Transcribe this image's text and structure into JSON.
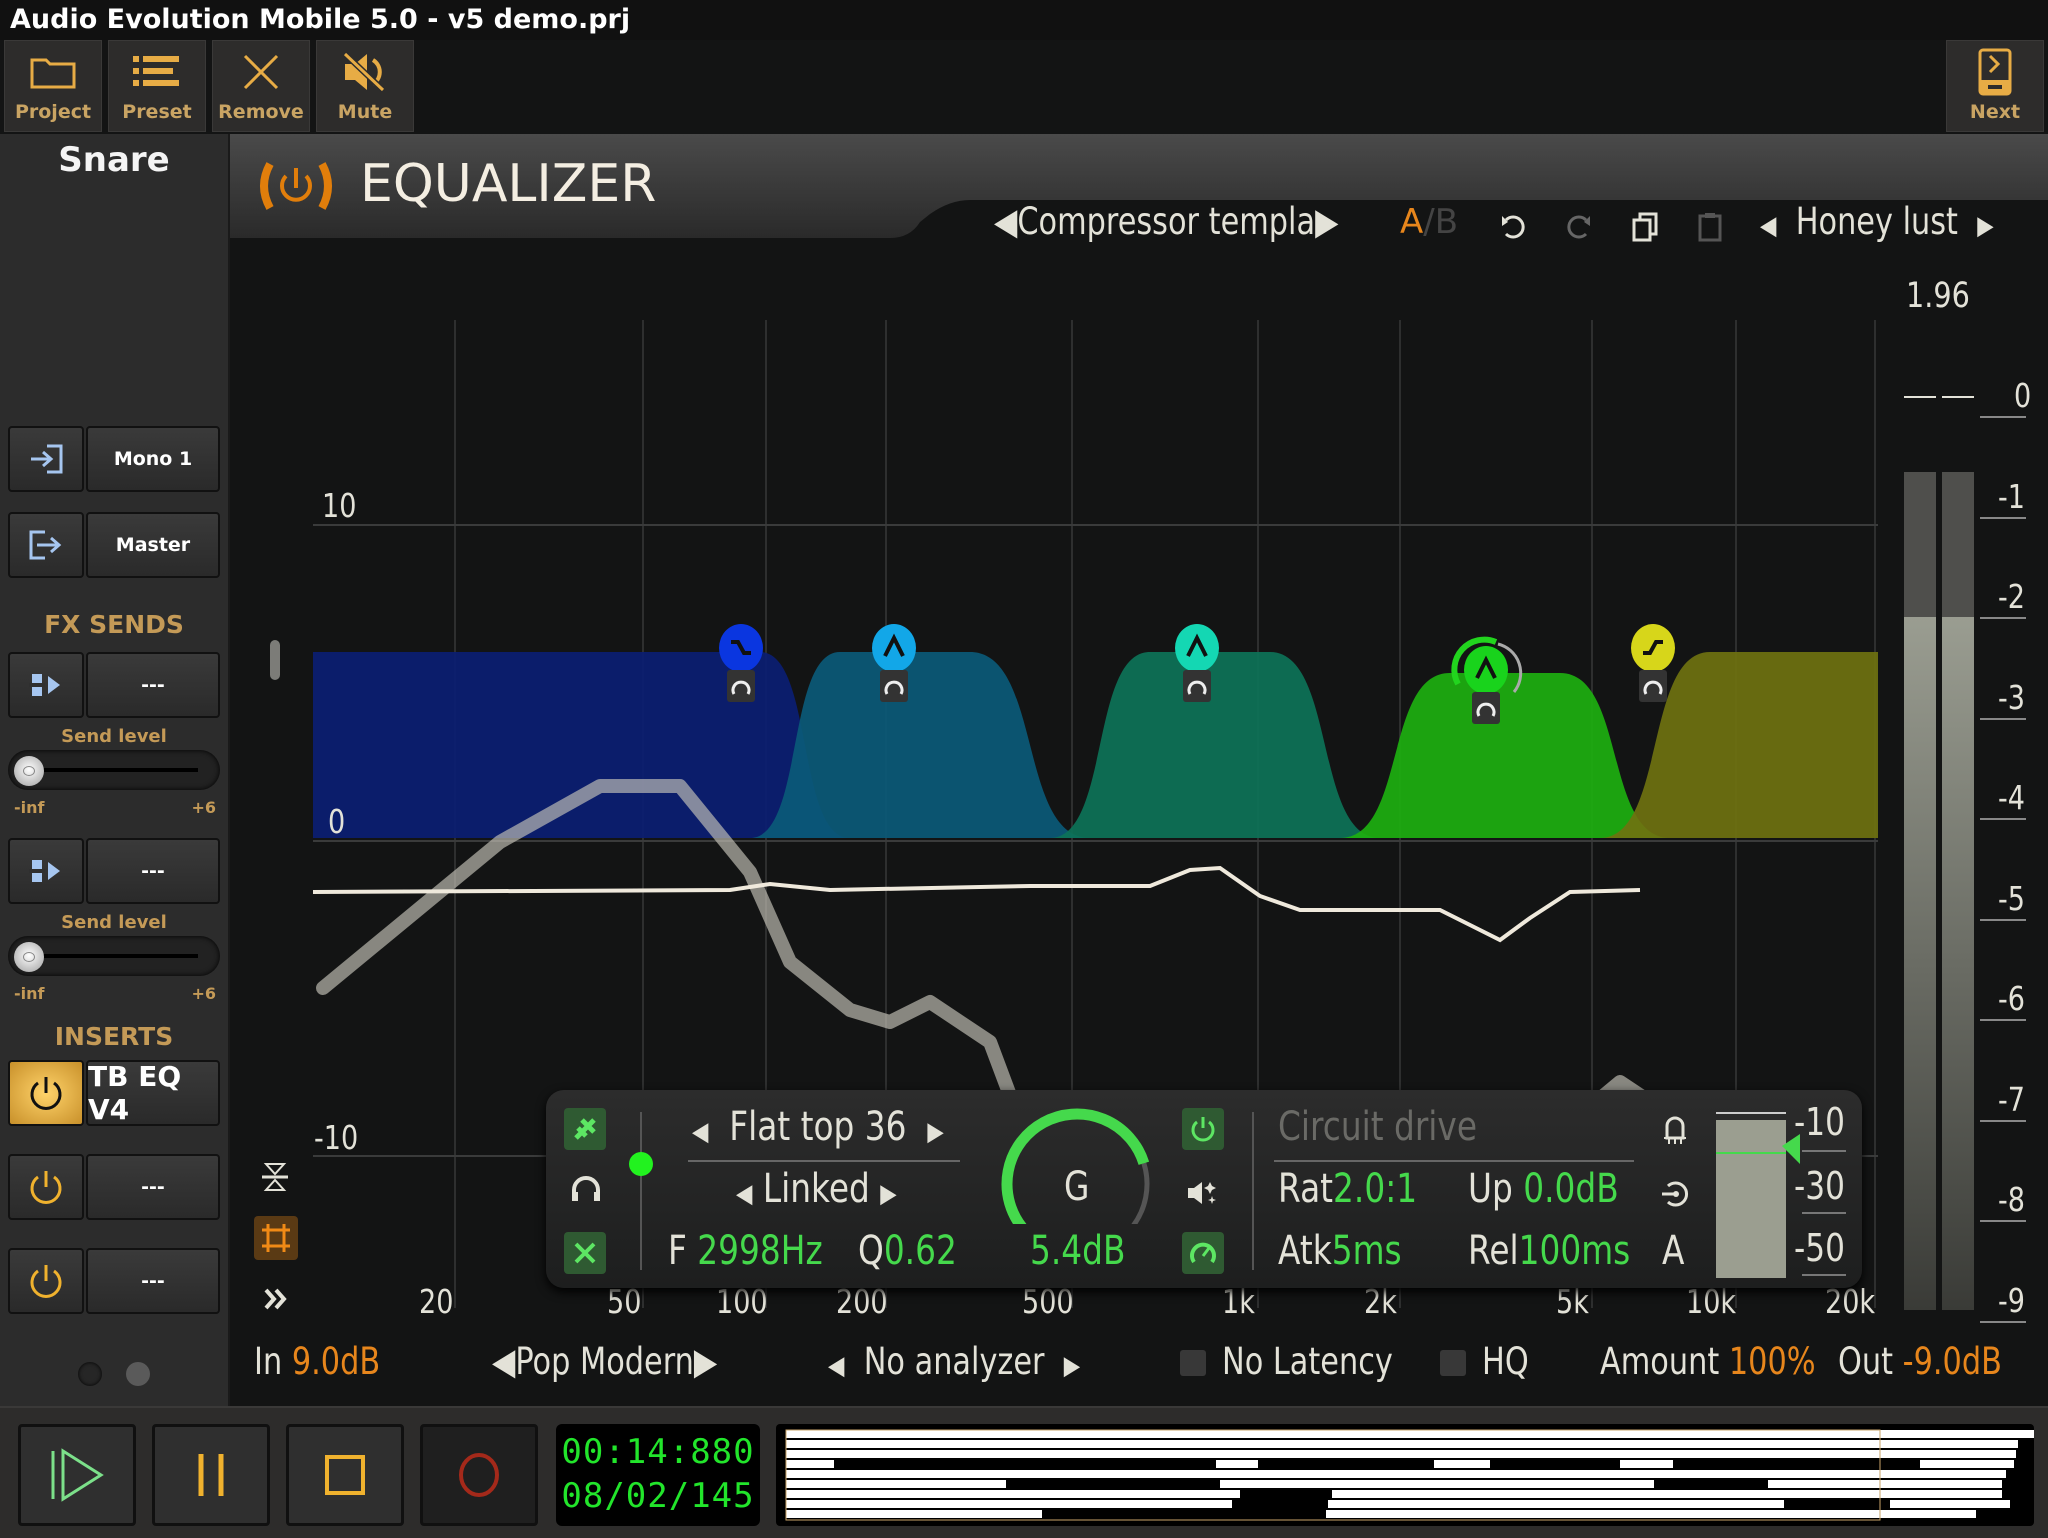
{
  "app": {
    "title": "Audio Evolution Mobile 5.0 - v5 demo.prj"
  },
  "toolbar": {
    "buttons": [
      {
        "label": "Project",
        "icon": "folder-icon"
      },
      {
        "label": "Preset",
        "icon": "list-icon"
      },
      {
        "label": "Remove",
        "icon": "close-icon"
      },
      {
        "label": "Mute",
        "icon": "mute-icon"
      }
    ],
    "next": {
      "label": "Next",
      "icon": "next-device-icon"
    }
  },
  "sidebar": {
    "track_name": "Snare",
    "input": {
      "label": "Mono 1",
      "icon": "input-icon"
    },
    "output": {
      "label": "Master",
      "icon": "output-icon"
    },
    "fx_sends_title": "FX SENDS",
    "sends": [
      {
        "label": "---",
        "level_label": "Send level",
        "min": "-inf",
        "max": "+6",
        "level_fraction": 0.0
      },
      {
        "label": "---",
        "level_label": "Send level",
        "min": "-inf",
        "max": "+6",
        "level_fraction": 0.0
      }
    ],
    "inserts_title": "INSERTS",
    "inserts": [
      {
        "label": "TB EQ V4",
        "enabled": true
      },
      {
        "label": "---",
        "enabled": false
      },
      {
        "label": "---",
        "enabled": false
      }
    ],
    "page_indicator": {
      "pages": 2,
      "current": 2
    }
  },
  "plugin": {
    "title": "EQUALIZER",
    "preset_left": "Compressor templa",
    "ab": {
      "a": "A",
      "sep": "/",
      "b": "B",
      "active": "A"
    },
    "preset_right": "Honey lust",
    "output_peak": "1.96"
  },
  "eq": {
    "db_labels": [
      "10",
      "0",
      "-10"
    ],
    "freq_labels": [
      "20",
      "50",
      "100",
      "200",
      "500",
      "1k",
      "2k",
      "5k",
      "10k",
      "20k"
    ],
    "bands": [
      {
        "type": "low-shelf",
        "color": "#0a36e0",
        "fill": "#0b1e73"
      },
      {
        "type": "bell",
        "color": "#12a7e8",
        "fill": "#0b5a78"
      },
      {
        "type": "bell",
        "color": "#14d7b3",
        "fill": "#0d7358"
      },
      {
        "type": "bell",
        "color": "#19d31c",
        "fill": "#1db010",
        "selected": true
      },
      {
        "type": "high-shelf",
        "color": "#d7d61a",
        "fill": "#6f7210"
      }
    ],
    "side_tools": [
      "compress-vertical-icon",
      "crop-icon",
      "double-chevron-icon"
    ]
  },
  "band_panel": {
    "filter_type": "Flat top 36",
    "stereo_mode": "Linked",
    "freq_label": "F",
    "freq_value": "2998Hz",
    "q_label": "Q",
    "q_value": "0.62",
    "gain_knob_label": "G",
    "gain_value": "5.4dB",
    "gain_fraction": 0.78,
    "dynamics_title": "Circuit drive",
    "ratio_label": "Rat",
    "ratio_value": "2.0:1",
    "up_label": "Up",
    "up_value": "0.0dB",
    "attack_label": "Atk",
    "attack_value": "5ms",
    "release_label": "Rel",
    "release_value": "100ms",
    "auto_label": "A",
    "threshold_scale": [
      "-10",
      "-30",
      "-50"
    ]
  },
  "meter": {
    "scale": [
      "0",
      "-1",
      "-2",
      "-3",
      "-4",
      "-5",
      "-6",
      "-7",
      "-8",
      "-9"
    ],
    "left_level_db": -2.0,
    "right_level_db": -2.0
  },
  "footer": {
    "in_label": "In",
    "in_value": "9.0dB",
    "style_preset": "Pop Modern",
    "analyzer": "No analyzer",
    "no_latency_label": "No Latency",
    "no_latency_checked": false,
    "hq_label": "HQ",
    "hq_checked": false,
    "amount_label": "Amount",
    "amount_value": "100%",
    "out_label": "Out",
    "out_value": "-9.0dB"
  },
  "transport": {
    "time": "00:14:880",
    "bars": "08/02/145",
    "buttons": [
      "play",
      "pause",
      "stop",
      "record"
    ]
  }
}
